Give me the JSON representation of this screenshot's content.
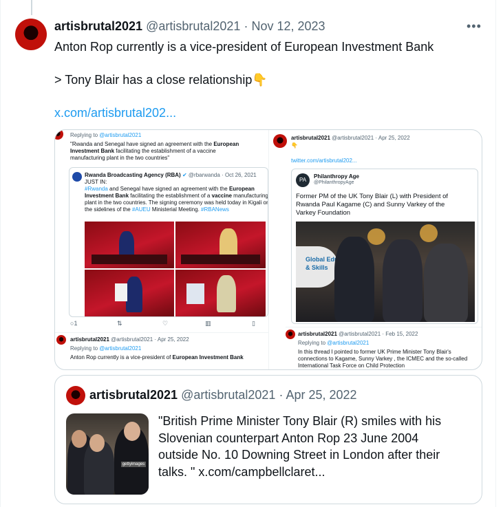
{
  "tweet": {
    "name": "artisbrutal2021",
    "handle": "@artisbrutal2021",
    "separator": "·",
    "date": "Nov 12, 2023",
    "more": "•••",
    "line1": "Anton Rop currently is a vice-president of European Investment Bank",
    "line2": "> Tony Blair has a close relationship",
    "emoji": "👇",
    "link": "x.com/artisbrutal202..."
  },
  "media_left": {
    "replying": "Replying to",
    "replying_handle": "@artisbrutal2021",
    "quote_text_1": "\"Rwanda and Senegal have signed an agreement with the",
    "quote_bold_1": "European",
    "quote_bold_2": "Investment Bank",
    "quote_text_2": "facilitating the establishment of a vaccine",
    "quote_text_3": "manufacturing plant in the two countries\"",
    "inner_name": "Rwanda Broadcasting Agency (RBA)",
    "inner_handle": "@rbarwanda · Oct 26, 2021",
    "inner_l1": "JUST IN:",
    "inner_tag1": "#Rwanda",
    "inner_l2": "and Senegal have signed an agreement with the",
    "inner_b1": "European",
    "inner_b2": "Investment Bank",
    "inner_l3": "facilitating the establishment of a",
    "inner_b3": "vaccine",
    "inner_l3b": "manufacturing",
    "inner_l4": "plant in the two countries. The signing ceremony was held today in Kigali on",
    "inner_l5": "the sidelines of the",
    "inner_tag2": "#AUEU",
    "inner_l5b": "Ministerial Meeting.",
    "inner_tag3": "#RBANews",
    "action_reply": "1",
    "bottom_name": "artisbrutal2021",
    "bottom_handle": "@artisbrutal2021 · Apr 25, 2022",
    "bottom_replying": "Replying to",
    "bottom_replying_handle": "@artisbrutal2021",
    "bottom_text": "Anton Rop currently is a vice-president of",
    "bottom_bold": "European Investment Bank"
  },
  "media_right": {
    "name": "artisbrutal2021",
    "handle": "@artisbrutal2021 · Apr 25, 2022",
    "emoji": "👇",
    "link": "twitter.com/artisbrutal202...",
    "card_name": "Philanthropy Age",
    "card_handle": "@PhilanthropyAge",
    "card_logo": "PA",
    "card_l1": "Former PM of the UK Tony Blair (L) with President of",
    "card_l2": "Rwanda Paul Kagame (C) and Sunny Varkey of the",
    "card_l3": "Varkey Foundation",
    "banner_l1": "Global Educat",
    "banner_l2": "& Skills",
    "bottom_name": "artisbrutal2021",
    "bottom_handle": "@artisbrutal2021 · Feb 15, 2022",
    "bottom_replying": "Replying to",
    "bottom_replying_handle": "@artisbrutal2021",
    "bottom_l1": "In this thread I pointed to former UK Prime Minister Tony Blair's",
    "bottom_l2": "connections to Kagame, Sunny Varkey , the ICMEC and the so-called",
    "bottom_l3": "International Task Force on Child Protection"
  },
  "quote": {
    "name": "artisbrutal2021",
    "handle": "@artisbrutal2021",
    "separator": "·",
    "date": "Apr 25, 2022",
    "l1": "\"British Prime Minister Tony Blair (R) smiles with his",
    "l2": "Slovenian counterpart Anton Rop 23 June 2004",
    "l3": "outside No. 10 Downing Street in London after their",
    "l4": "talks. \"",
    "link": "x.com/campbellclaret...",
    "photo_watermark": "gettyimages"
  }
}
